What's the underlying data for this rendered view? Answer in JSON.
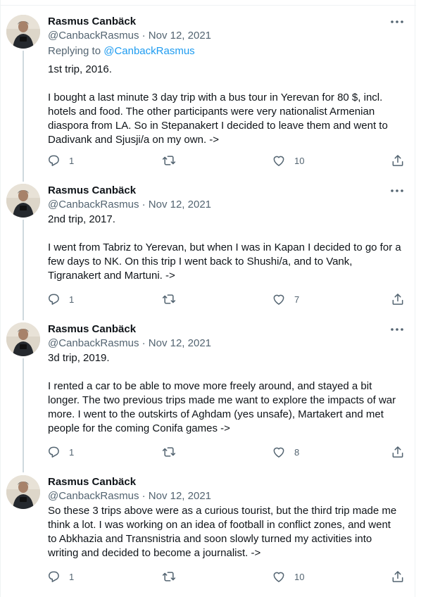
{
  "tweets": [
    {
      "name": "Rasmus Canbäck",
      "meta": "@CanbackRasmus · Nov 12, 2021",
      "replying_prefix": "Replying to ",
      "replying_handle": "@CanbackRasmus",
      "text": "1st trip, 2016.\n\nI bought a last minute 3 day trip with a bus tour in Yerevan for 80 $, incl.\nhotels and food. The other participants were very nationalist Armenian\ndiaspora from LA. So in Stepanakert I decided to leave them and went to\nDadivank and Sjusji/a on my own. ->",
      "replies": "1",
      "likes": "10"
    },
    {
      "name": "Rasmus Canbäck",
      "meta": "@CanbackRasmus · Nov 12, 2021",
      "text": "2nd trip, 2017.\n\nI went from Tabriz to Yerevan, but when I was in Kapan I decided to go for a\nfew days to NK. On this trip I went back to Shushi/a, and to Vank,\nTigranakert and Martuni. ->",
      "replies": "1",
      "likes": "7"
    },
    {
      "name": "Rasmus Canbäck",
      "meta": "@CanbackRasmus · Nov 12, 2021",
      "text": "3d trip, 2019.\n\nI rented a car to be able to move more freely around, and stayed a bit\nlonger. The two previous trips made me want to explore the impacts of war\nmore. I went to the outskirts of Aghdam (yes unsafe), Martakert and met\npeople for the coming Conifa games ->",
      "replies": "1",
      "likes": "8"
    },
    {
      "name": "Rasmus Canbäck",
      "meta": "@CanbackRasmus · Nov 12, 2021",
      "text": "So these 3 trips above were as a curious tourist, but the third trip made me\nthink a lot. I was working on an idea of football in conflict zones, and went\nto Abkhazia and Transnistria and soon slowly turned my activities into\nwriting and decided to become a journalist. ->",
      "replies": "1",
      "likes": "10"
    }
  ],
  "icons": {
    "reply": "reply-icon",
    "retweet": "retweet-icon",
    "like": "heart-icon",
    "share": "share-icon",
    "more": "more-icon"
  },
  "colors": {
    "text": "#0f1419",
    "secondary": "#536471",
    "link": "#1d9bf0",
    "thread_line": "#cfd9de"
  }
}
